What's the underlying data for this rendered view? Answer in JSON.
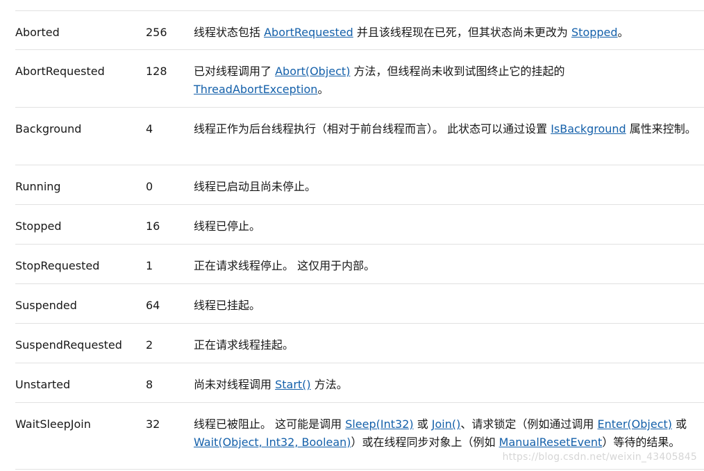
{
  "rows": [
    {
      "name": "Aborted",
      "value": "256",
      "parts": [
        {
          "t": "线程状态包括 "
        },
        {
          "t": "AbortRequested",
          "link": true
        },
        {
          "t": " 并且该线程现在已死，但其状态尚未更改为 "
        },
        {
          "t": "Stopped",
          "link": true
        },
        {
          "t": "。"
        }
      ]
    },
    {
      "name": "AbortRequested",
      "value": "128",
      "parts": [
        {
          "t": "已对线程调用了 "
        },
        {
          "t": "Abort(Object)",
          "link": true
        },
        {
          "t": " 方法，但线程尚未收到试图终止它的挂起的 "
        },
        {
          "t": "ThreadAbortException",
          "link": true
        },
        {
          "t": "。"
        }
      ]
    },
    {
      "name": "Background",
      "value": "4",
      "parts": [
        {
          "t": "线程正作为后台线程执行（相对于前台线程而言）。 此状态可以通过设置 "
        },
        {
          "t": "IsBackground",
          "link": true
        },
        {
          "t": " 属性来控制。"
        }
      ]
    },
    {
      "name": "Running",
      "value": "0",
      "parts": [
        {
          "t": "线程已启动且尚未停止。"
        }
      ]
    },
    {
      "name": "Stopped",
      "value": "16",
      "parts": [
        {
          "t": "线程已停止。"
        }
      ]
    },
    {
      "name": "StopRequested",
      "value": "1",
      "parts": [
        {
          "t": "正在请求线程停止。 这仅用于内部。"
        }
      ]
    },
    {
      "name": "Suspended",
      "value": "64",
      "parts": [
        {
          "t": "线程已挂起。"
        }
      ]
    },
    {
      "name": "SuspendRequested",
      "value": "2",
      "parts": [
        {
          "t": "正在请求线程挂起。"
        }
      ]
    },
    {
      "name": "Unstarted",
      "value": "8",
      "parts": [
        {
          "t": "尚未对线程调用 "
        },
        {
          "t": "Start()",
          "link": true
        },
        {
          "t": " 方法。"
        }
      ]
    },
    {
      "name": "WaitSleepJoin",
      "value": "32",
      "parts": [
        {
          "t": "线程已被阻止。 这可能是调用 "
        },
        {
          "t": "Sleep(Int32)",
          "link": true
        },
        {
          "t": " 或 "
        },
        {
          "t": "Join()",
          "link": true
        },
        {
          "t": "、请求锁定（例如通过调用 "
        },
        {
          "t": "Enter(Object)",
          "link": true
        },
        {
          "t": " 或 "
        },
        {
          "t": "Wait(Object, Int32, Boolean)",
          "link": true
        },
        {
          "t": "）或在线程同步对象上（例如 "
        },
        {
          "t": "ManualResetEvent",
          "link": true
        },
        {
          "t": "）等待的结果。"
        }
      ]
    }
  ],
  "watermark": "https://blog.csdn.net/weixin_43405845"
}
